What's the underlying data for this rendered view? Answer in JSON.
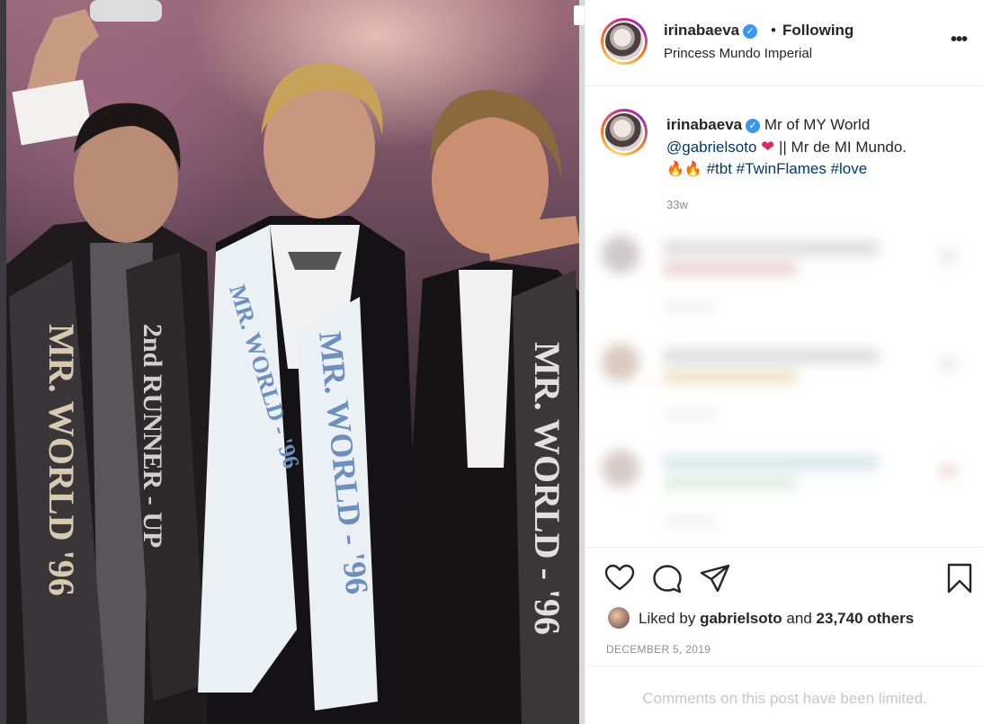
{
  "photo": {
    "sash_left_text": "MR. WORLD '96",
    "sash_left_runner": "2nd RUNNER - UP",
    "sash_center_text": "MR. WORLD - '96",
    "sash_right_text": "MR. WORLD - '96"
  },
  "header": {
    "username": "irinabaeva",
    "separator": "•",
    "follow_status": "Following",
    "location": "Princess Mundo Imperial",
    "more_icon": "ellipsis-icon",
    "more_glyph": "•••"
  },
  "caption": {
    "username": "irinabaeva",
    "text_1": "Mr of MY World",
    "mention": "@gabrielsoto",
    "heart": "❤",
    "text_2": "|| Mr de MI Mundo.",
    "fire": "🔥🔥",
    "tag_1": "#tbt",
    "tag_2": "#TwinFlames",
    "tag_3": "#love",
    "time_ago": "33w"
  },
  "actions": {
    "like_icon": "heart-outline-icon",
    "comment_icon": "comment-bubble-icon",
    "share_icon": "paper-plane-icon",
    "save_icon": "bookmark-icon"
  },
  "likes": {
    "prefix": "Liked by",
    "user": "gabrielsoto",
    "and": "and",
    "others": "23,740 others"
  },
  "date": "DECEMBER 5, 2019",
  "comments_limited": "Comments on this post have been limited.",
  "colors": {
    "link": "#00376b",
    "verified": "#3897f0",
    "muted": "#8e8e8e",
    "border": "#efefef"
  }
}
